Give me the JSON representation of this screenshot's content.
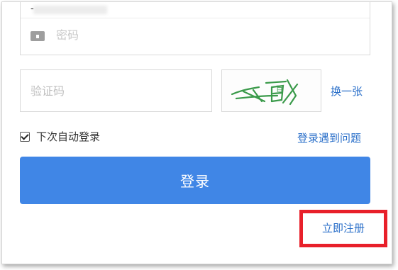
{
  "form": {
    "username_value": "-",
    "password_placeholder": "密码",
    "captcha_placeholder": "验证码",
    "captcha_image_text": "百",
    "refresh_label": "换一张",
    "remember_label": "下次自动登录",
    "remember_checked": true,
    "problem_link": "登录遇到问题",
    "login_button": "登录",
    "register_link": "立即注册"
  },
  "colors": {
    "primary": "#4086e6",
    "link": "#2a6fc9",
    "highlight": "#e8202a",
    "captcha_ink": "#3a9a4a"
  }
}
